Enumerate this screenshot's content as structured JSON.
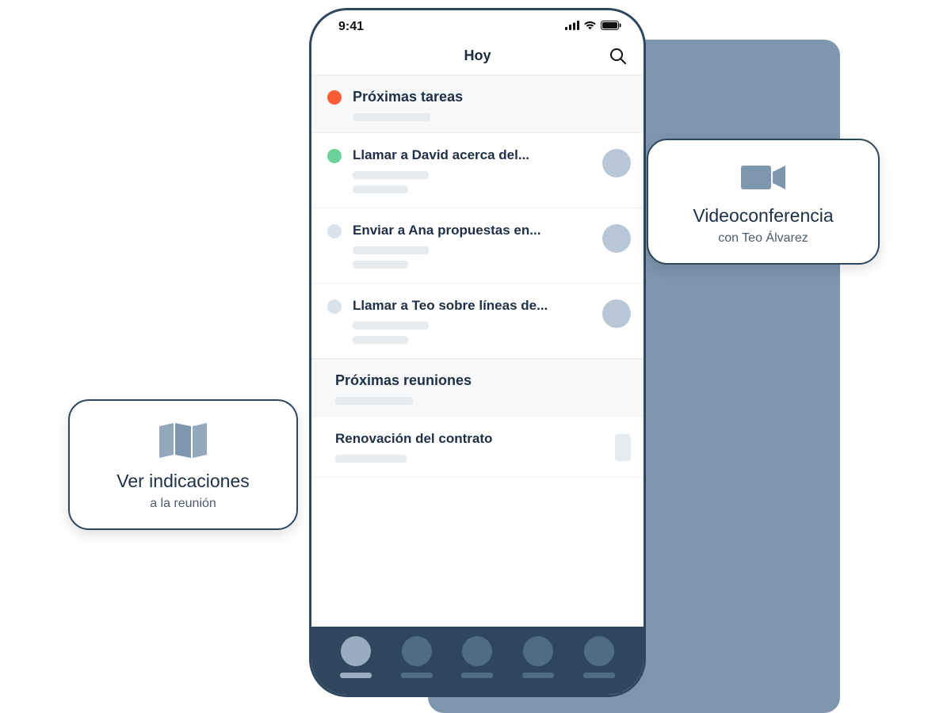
{
  "status": {
    "time": "9:41"
  },
  "navbar": {
    "title": "Hoy"
  },
  "sections": {
    "tasks": {
      "header": "Próximas tareas",
      "items": [
        {
          "title": "Llamar a David acerca del...",
          "dot": "green"
        },
        {
          "title": "Enviar a Ana propuestas en...",
          "dot": "gray"
        },
        {
          "title": "Llamar a Teo sobre líneas de...",
          "dot": "gray"
        }
      ]
    },
    "meetings": {
      "header": "Próximas reuniones",
      "items": [
        {
          "title": "Renovación del contrato"
        }
      ]
    }
  },
  "callouts": {
    "directions": {
      "title": "Ver indicaciones",
      "subtitle": "a la reunión"
    },
    "video": {
      "title": "Videoconferencia",
      "subtitle": "con Teo Álvarez"
    }
  }
}
